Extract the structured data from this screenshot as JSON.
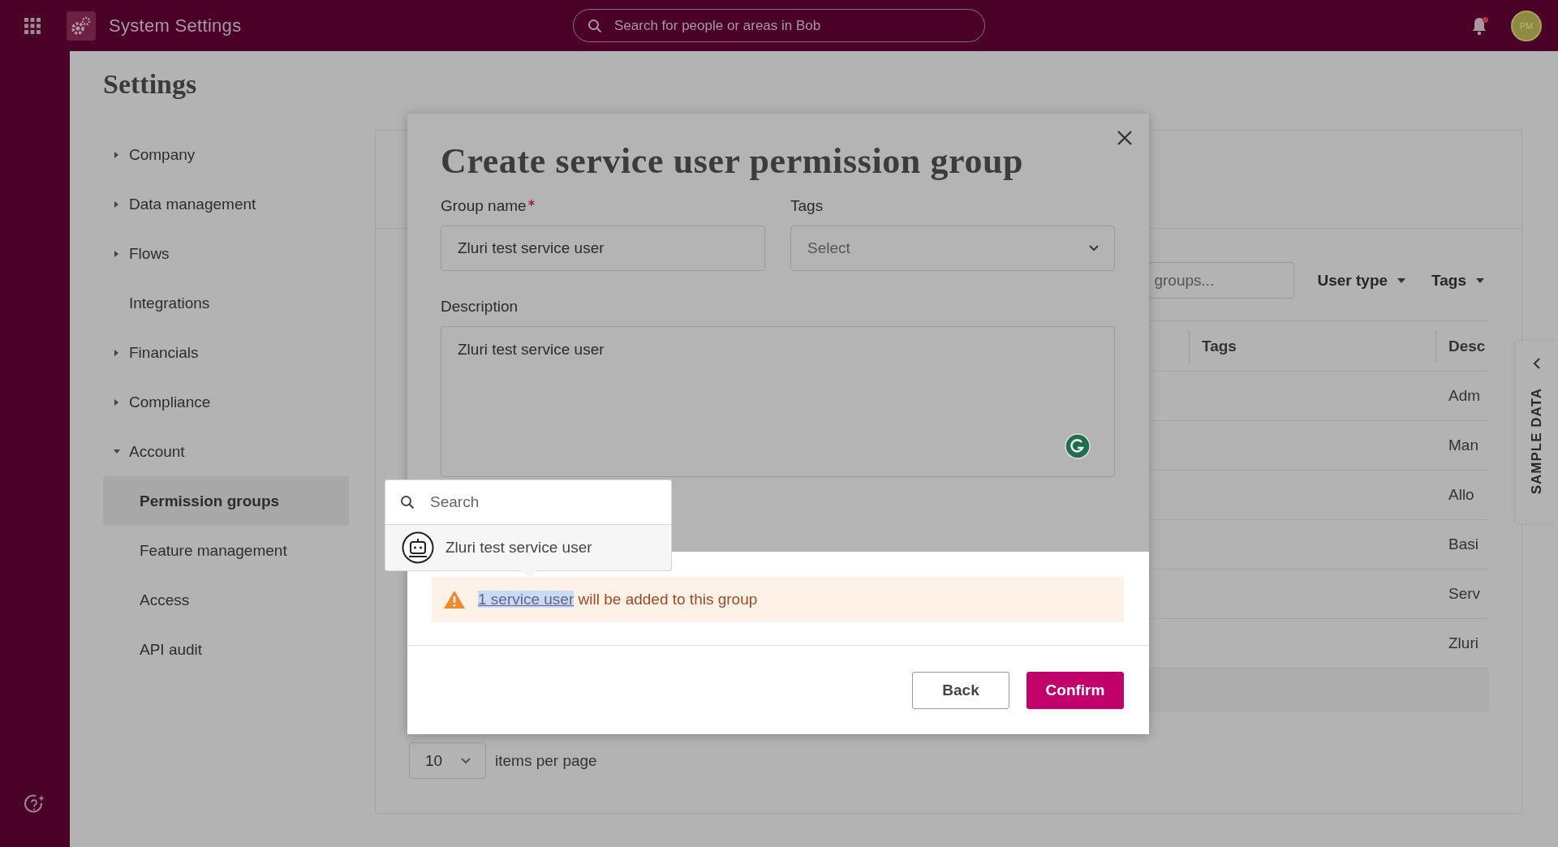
{
  "topbar": {
    "app_title": "System Settings",
    "search_placeholder": "Search for people or areas in Bob",
    "avatar_initials": "PM",
    "notification_unread": true
  },
  "settings": {
    "title": "Settings",
    "nav": [
      {
        "label": "Company",
        "kind": "group",
        "expanded": false,
        "selected": false
      },
      {
        "label": "Data management",
        "kind": "group",
        "expanded": false,
        "selected": false
      },
      {
        "label": "Flows",
        "kind": "group",
        "expanded": false,
        "selected": false
      },
      {
        "label": "Integrations",
        "kind": "page",
        "selected": false
      },
      {
        "label": "Financials",
        "kind": "group",
        "expanded": false,
        "selected": false
      },
      {
        "label": "Compliance",
        "kind": "group",
        "expanded": false,
        "selected": false
      },
      {
        "label": "Account",
        "kind": "group",
        "expanded": true,
        "selected": false,
        "children": [
          {
            "label": "Permission groups",
            "selected": true
          },
          {
            "label": "Feature management",
            "selected": false
          },
          {
            "label": "Access",
            "selected": false
          },
          {
            "label": "API audit",
            "selected": false
          }
        ]
      }
    ]
  },
  "panel": {
    "search_placeholder": "groups...",
    "filters": [
      "User type",
      "Tags"
    ],
    "table": {
      "columns": [
        "Tags",
        "Desc"
      ],
      "rows": [
        {
          "column_3": "Adm"
        },
        {
          "column_3": "Man"
        },
        {
          "column_3": "Allo"
        },
        {
          "column_3": "Basi"
        },
        {
          "column_3": "Serv"
        },
        {
          "column_3": "Zluri"
        }
      ]
    },
    "pagination": {
      "page_size": "10",
      "label": "items per page"
    }
  },
  "sample_data_tab": {
    "label": "SAMPLE DATA"
  },
  "modal": {
    "title": "Create service user permission group",
    "group_name": {
      "label": "Group name",
      "required": true,
      "value": "Zluri test service user"
    },
    "tags": {
      "label": "Tags",
      "placeholder": "Select"
    },
    "description": {
      "label": "Description",
      "value": "Zluri test service user"
    },
    "dropdown": {
      "search_placeholder": "Search",
      "options": [
        {
          "label": "Zluri test service user"
        }
      ]
    },
    "notice": {
      "link": "1 service user",
      "text": "will be added to this group"
    },
    "buttons": [
      {
        "label": "Back",
        "kind": "secondary"
      },
      {
        "label": "Confirm",
        "kind": "primary"
      }
    ]
  }
}
